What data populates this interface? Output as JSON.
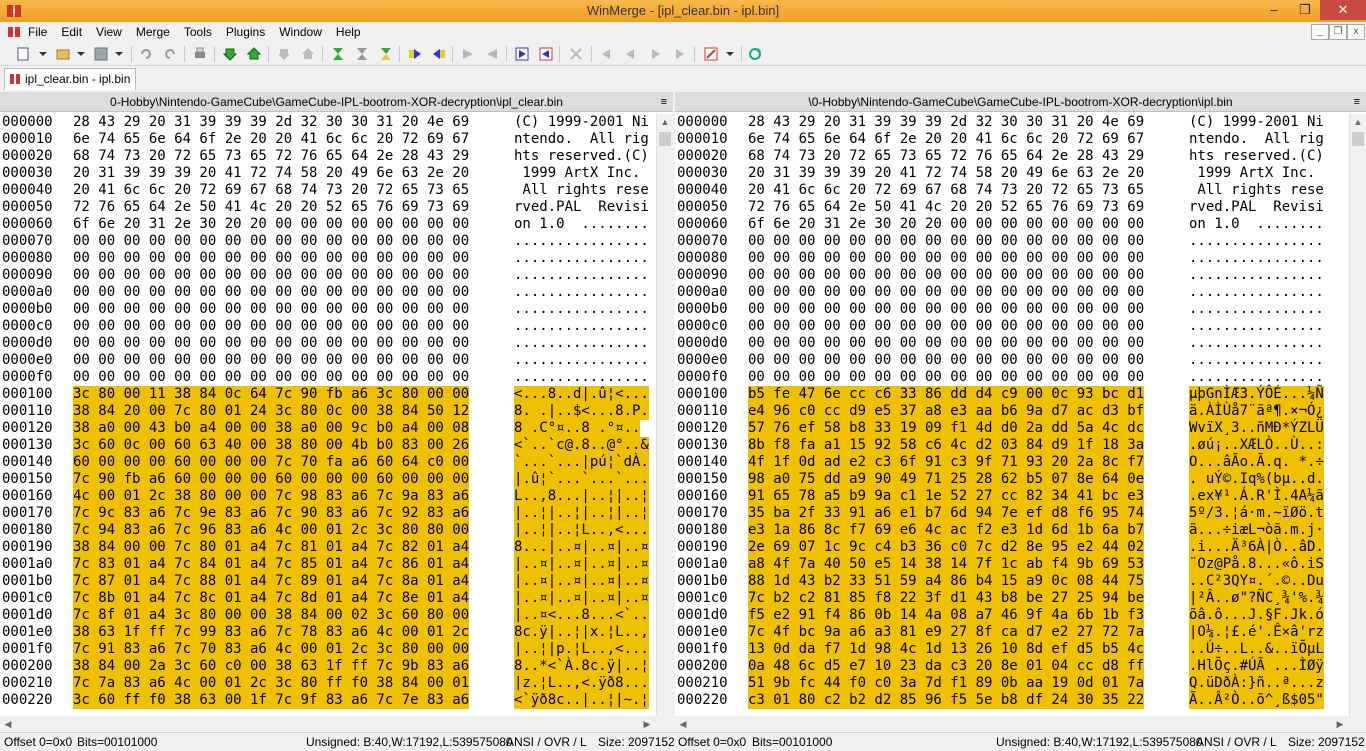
{
  "window": {
    "title": "WinMerge - [ipl_clear.bin - ipl.bin]",
    "minimize": "–",
    "maximize": "❐",
    "close": "✕"
  },
  "menu": [
    "File",
    "Edit",
    "View",
    "Merge",
    "Tools",
    "Plugins",
    "Window",
    "Help"
  ],
  "tab": {
    "label": "ipl_clear.bin - ipl.bin"
  },
  "colors": {
    "diff": "#efc000",
    "titlebar": "#f0a020"
  },
  "left": {
    "path": "0-Hobby\\Nintendo-GameCube\\GameCube-IPL-bootrom-XOR-decryption\\ipl_clear.bin",
    "rows": [
      {
        "o": "000000",
        "b": "28 43 29 20 31 39 39 39 2d 32 30 30 31 20 4e 69",
        "a": "(C) 1999-2001 Ni",
        "d": false
      },
      {
        "o": "000010",
        "b": "6e 74 65 6e 64 6f 2e 20 20 41 6c 6c 20 72 69 67",
        "a": "ntendo.  All rig",
        "d": false
      },
      {
        "o": "000020",
        "b": "68 74 73 20 72 65 73 65 72 76 65 64 2e 28 43 29",
        "a": "hts reserved.(C)",
        "d": false
      },
      {
        "o": "000030",
        "b": "20 31 39 39 39 20 41 72 74 58 20 49 6e 63 2e 20",
        "a": " 1999 ArtX Inc. ",
        "d": false
      },
      {
        "o": "000040",
        "b": "20 41 6c 6c 20 72 69 67 68 74 73 20 72 65 73 65",
        "a": " All rights rese",
        "d": false
      },
      {
        "o": "000050",
        "b": "72 76 65 64 2e 50 41 4c 20 20 52 65 76 69 73 69",
        "a": "rved.PAL  Revisi",
        "d": false
      },
      {
        "o": "000060",
        "b": "6f 6e 20 31 2e 30 20 20 00 00 00 00 00 00 00 00",
        "a": "on 1.0  ........",
        "d": false
      },
      {
        "o": "000070",
        "b": "00 00 00 00 00 00 00 00 00 00 00 00 00 00 00 00",
        "a": "................",
        "d": false
      },
      {
        "o": "000080",
        "b": "00 00 00 00 00 00 00 00 00 00 00 00 00 00 00 00",
        "a": "................",
        "d": false
      },
      {
        "o": "000090",
        "b": "00 00 00 00 00 00 00 00 00 00 00 00 00 00 00 00",
        "a": "................",
        "d": false
      },
      {
        "o": "0000a0",
        "b": "00 00 00 00 00 00 00 00 00 00 00 00 00 00 00 00",
        "a": "................",
        "d": false
      },
      {
        "o": "0000b0",
        "b": "00 00 00 00 00 00 00 00 00 00 00 00 00 00 00 00",
        "a": "................",
        "d": false
      },
      {
        "o": "0000c0",
        "b": "00 00 00 00 00 00 00 00 00 00 00 00 00 00 00 00",
        "a": "................",
        "d": false
      },
      {
        "o": "0000d0",
        "b": "00 00 00 00 00 00 00 00 00 00 00 00 00 00 00 00",
        "a": "................",
        "d": false
      },
      {
        "o": "0000e0",
        "b": "00 00 00 00 00 00 00 00 00 00 00 00 00 00 00 00",
        "a": "................",
        "d": false
      },
      {
        "o": "0000f0",
        "b": "00 00 00 00 00 00 00 00 00 00 00 00 00 00 00 00",
        "a": "................",
        "d": false
      },
      {
        "o": "000100",
        "b": "3c 80 00 11 38 84 0c 64 7c 90 fb a6 3c 80 00 00",
        "a": "<...8..d|.û¦<...",
        "d": true
      },
      {
        "o": "000110",
        "b": "38 84 20 00 7c 80 01 24 3c 80 0c 00 38 84 50 12",
        "a": "8. .|..$<...8.P.",
        "d": true
      },
      {
        "o": "000120",
        "b": "38 a0 00 43 b0 a4 00 00 38 a0 00 9c b0 a4 00 08",
        "a": "8 .C°¤..8 .°¤..",
        "d": true
      },
      {
        "o": "000130",
        "b": "3c 60 0c 00 60 63 40 00 38 80 00 4b b0 83 00 26",
        "a": "<`..`c@.8..@°..&",
        "d": true
      },
      {
        "o": "000140",
        "b": "60 00 00 00 60 00 00 00 7c 70 fa a6 60 64 c0 00",
        "a": "`...`...|pú¦`dÀ.",
        "d": true
      },
      {
        "o": "000150",
        "b": "7c 90 fb a6 60 00 00 00 60 00 00 00 60 00 00 00",
        "a": "|.û¦`...`...`...",
        "d": true
      },
      {
        "o": "000160",
        "b": "4c 00 01 2c 38 80 00 00 7c 98 83 a6 7c 9a 83 a6",
        "a": "L..,8...|..¦|..¦",
        "d": true
      },
      {
        "o": "000170",
        "b": "7c 9c 83 a6 7c 9e 83 a6 7c 90 83 a6 7c 92 83 a6",
        "a": "|..¦|..¦|..¦|..¦",
        "d": true
      },
      {
        "o": "000180",
        "b": "7c 94 83 a6 7c 96 83 a6 4c 00 01 2c 3c 80 80 00",
        "a": "|..¦|..¦L..,<...",
        "d": true
      },
      {
        "o": "000190",
        "b": "38 84 00 00 7c 80 01 a4 7c 81 01 a4 7c 82 01 a4",
        "a": "8...|..¤|..¤|..¤",
        "d": true
      },
      {
        "o": "0001a0",
        "b": "7c 83 01 a4 7c 84 01 a4 7c 85 01 a4 7c 86 01 a4",
        "a": "|..¤|..¤|..¤|..¤",
        "d": true
      },
      {
        "o": "0001b0",
        "b": "7c 87 01 a4 7c 88 01 a4 7c 89 01 a4 7c 8a 01 a4",
        "a": "|..¤|..¤|..¤|..¤",
        "d": true
      },
      {
        "o": "0001c0",
        "b": "7c 8b 01 a4 7c 8c 01 a4 7c 8d 01 a4 7c 8e 01 a4",
        "a": "|..¤|..¤|..¤|..¤",
        "d": true
      },
      {
        "o": "0001d0",
        "b": "7c 8f 01 a4 3c 80 00 00 38 84 00 02 3c 60 80 00",
        "a": "|..¤<...8...<`..",
        "d": true
      },
      {
        "o": "0001e0",
        "b": "38 63 1f ff 7c 99 83 a6 7c 78 83 a6 4c 00 01 2c",
        "a": "8c.ÿ|..¦|x.¦L..,",
        "d": true
      },
      {
        "o": "0001f0",
        "b": "7c 91 83 a6 7c 70 83 a6 4c 00 01 2c 3c 80 00 00",
        "a": "|..¦|p.¦L..,<...",
        "d": true
      },
      {
        "o": "000200",
        "b": "38 84 00 2a 3c 60 c0 00 38 63 1f ff 7c 9b 83 a6",
        "a": "8..*<`À.8c.ÿ|..¦",
        "d": true
      },
      {
        "o": "000210",
        "b": "7c 7a 83 a6 4c 00 01 2c 3c 80 ff f0 38 84 00 01",
        "a": "|z.¦L..,<.ÿð8...",
        "d": true
      },
      {
        "o": "000220",
        "b": "3c 60 ff f0 38 63 00 1f 7c 9f 83 a6 7c 7e 83 a6",
        "a": "<`ÿð8c..|..¦|~.¦",
        "d": true
      }
    ]
  },
  "right": {
    "path": "\\0-Hobby\\Nintendo-GameCube\\GameCube-IPL-bootrom-XOR-decryption\\ipl.bin",
    "rows": [
      {
        "o": "000000",
        "b": "28 43 29 20 31 39 39 39 2d 32 30 30 31 20 4e 69",
        "a": "(C) 1999-2001 Ni",
        "d": false
      },
      {
        "o": "000010",
        "b": "6e 74 65 6e 64 6f 2e 20 20 41 6c 6c 20 72 69 67",
        "a": "ntendo.  All rig",
        "d": false
      },
      {
        "o": "000020",
        "b": "68 74 73 20 72 65 73 65 72 76 65 64 2e 28 43 29",
        "a": "hts reserved.(C)",
        "d": false
      },
      {
        "o": "000030",
        "b": "20 31 39 39 39 20 41 72 74 58 20 49 6e 63 2e 20",
        "a": " 1999 ArtX Inc. ",
        "d": false
      },
      {
        "o": "000040",
        "b": "20 41 6c 6c 20 72 69 67 68 74 73 20 72 65 73 65",
        "a": " All rights rese",
        "d": false
      },
      {
        "o": "000050",
        "b": "72 76 65 64 2e 50 41 4c 20 20 52 65 76 69 73 69",
        "a": "rved.PAL  Revisi",
        "d": false
      },
      {
        "o": "000060",
        "b": "6f 6e 20 31 2e 30 20 20 00 00 00 00 00 00 00 00",
        "a": "on 1.0  ........",
        "d": false
      },
      {
        "o": "000070",
        "b": "00 00 00 00 00 00 00 00 00 00 00 00 00 00 00 00",
        "a": "................",
        "d": false
      },
      {
        "o": "000080",
        "b": "00 00 00 00 00 00 00 00 00 00 00 00 00 00 00 00",
        "a": "................",
        "d": false
      },
      {
        "o": "000090",
        "b": "00 00 00 00 00 00 00 00 00 00 00 00 00 00 00 00",
        "a": "................",
        "d": false
      },
      {
        "o": "0000a0",
        "b": "00 00 00 00 00 00 00 00 00 00 00 00 00 00 00 00",
        "a": "................",
        "d": false
      },
      {
        "o": "0000b0",
        "b": "00 00 00 00 00 00 00 00 00 00 00 00 00 00 00 00",
        "a": "................",
        "d": false
      },
      {
        "o": "0000c0",
        "b": "00 00 00 00 00 00 00 00 00 00 00 00 00 00 00 00",
        "a": "................",
        "d": false
      },
      {
        "o": "0000d0",
        "b": "00 00 00 00 00 00 00 00 00 00 00 00 00 00 00 00",
        "a": "................",
        "d": false
      },
      {
        "o": "0000e0",
        "b": "00 00 00 00 00 00 00 00 00 00 00 00 00 00 00 00",
        "a": "................",
        "d": false
      },
      {
        "o": "0000f0",
        "b": "00 00 00 00 00 00 00 00 00 00 00 00 00 00 00 00",
        "a": "................",
        "d": false
      },
      {
        "o": "000100",
        "b": "b5 fe 47 6e cc c6 33 86 dd d4 c9 00 0c 93 bc d1",
        "a": "µþGnÌÆ3.ÝÔÉ...¼Ñ",
        "d": true
      },
      {
        "o": "000110",
        "b": "e4 96 c0 cc d9 e5 37 a8 e3 aa b6 9a d7 ac d3 bf",
        "a": "ä.ÀÌÙå7¨ãª¶.×¬Ó¿",
        "d": true
      },
      {
        "o": "000120",
        "b": "57 76 ef 58 b8 33 19 09 f1 4d d0 2a dd 5a 4c dc",
        "a": "WvïX¸3..ñMÐ*ÝZLÜ",
        "d": true
      },
      {
        "o": "000130",
        "b": "8b f8 fa a1 15 92 58 c6 4c d2 03 84 d9 1f 18 3a",
        "a": ".øú¡..XÆLÒ..Ù..:",
        "d": true
      },
      {
        "o": "000140",
        "b": "4f 1f 0d ad e2 c3 6f 91 c3 9f 71 93 20 2a 8c f7",
        "a": "O...âÃo.Ã.q. *.÷",
        "d": true
      },
      {
        "o": "000150",
        "b": "98 a0 75 dd a9 90 49 71 25 28 62 b5 07 8e 64 0e",
        "a": ". uÝ©.Iq%(bµ..d.",
        "d": true
      },
      {
        "o": "000160",
        "b": "91 65 78 a5 b9 9a c1 1e 52 27 cc 82 34 41 bc e3",
        "a": ".ex¥¹.Á.R'Ì.4A¼ã",
        "d": true
      },
      {
        "o": "000170",
        "b": "35 ba 2f 33 91 a6 e1 b7 6d 94 7e ef d8 f6 95 74",
        "a": "5º/3.¦á·m.~ïØö.t",
        "d": true
      },
      {
        "o": "000180",
        "b": "e3 1a 86 8c f7 69 e6 4c ac f2 e3 1d 6d 1b 6a b7",
        "a": "ã...÷iæL¬òã.m.j·",
        "d": true
      },
      {
        "o": "000190",
        "b": "2e 69 07 1c 9c c4 b3 36 c0 7c d2 8e 95 e2 44 02",
        "a": ".i...Ä³6À|Ò..âD.",
        "d": true
      },
      {
        "o": "0001a0",
        "b": "a8 4f 7a 40 50 e5 14 38 14 7f 1c ab f4 9b 69 53",
        "a": "¨Oz@På.8...«ô.iS",
        "d": true
      },
      {
        "o": "0001b0",
        "b": "88 1d 43 b2 33 51 59 a4 86 b4 15 a9 0c 08 44 75",
        "a": "..C²3QY¤.´.©..Du",
        "d": true
      },
      {
        "o": "0001c0",
        "b": "7c b2 c2 81 85 f8 22 3f d1 43 b8 be 27 25 94 be",
        "a": "|²Â..ø\"?ÑC¸¾'%.¾",
        "d": true
      },
      {
        "o": "0001d0",
        "b": "f5 e2 91 f4 86 0b 14 4a 08 a7 46 9f 4a 6b 1b f3",
        "a": "õâ.ô...J.§F.Jk.ó",
        "d": true
      },
      {
        "o": "0001e0",
        "b": "7c 4f bc 9a a6 a3 81 e9 27 8f ca d7 e2 27 72 7a",
        "a": "|O¼.¦£.é'.Ê×â'rz",
        "d": true
      },
      {
        "o": "0001f0",
        "b": "13 0d da f7 1d 98 4c 1d 13 26 10 8d ef d5 b5 4c",
        "a": "..Ú÷..L..&..ïÕµL",
        "d": true
      },
      {
        "o": "000200",
        "b": "0a 48 6c d5 e7 10 23 da c3 20 8e 01 04 cc d8 ff",
        "a": ".HlÕç.#ÚÃ ...ÌØÿ",
        "d": true
      },
      {
        "o": "000210",
        "b": "51 9b fc 44 f0 c0 3a 7d f1 89 0b aa 19 0d 01 7a",
        "a": "Q.üDðÀ:}ñ..ª...z",
        "d": true
      },
      {
        "o": "000220",
        "b": "c3 01 80 c2 b2 d2 85 96 f5 5e b8 df 24 30 35 22",
        "a": "Ã..Â²Ò..õ^¸ß$05\"",
        "d": true
      }
    ]
  },
  "status": {
    "left": {
      "offset": "Offset 0=0x0",
      "bits": "Bits=00101000",
      "unsigned": "Unsigned: B:40,W:17192,L:539575080",
      "mode": "ANSI / OVR / L",
      "size": "Size: 2097152"
    },
    "right": {
      "offset": "Offset 0=0x0",
      "bits": "Bits=00101000",
      "unsigned": "Unsigned: B:40,W:17192,L:539575080",
      "mode": "ANSI / OVR / L",
      "size": "Size: 2097152"
    }
  }
}
